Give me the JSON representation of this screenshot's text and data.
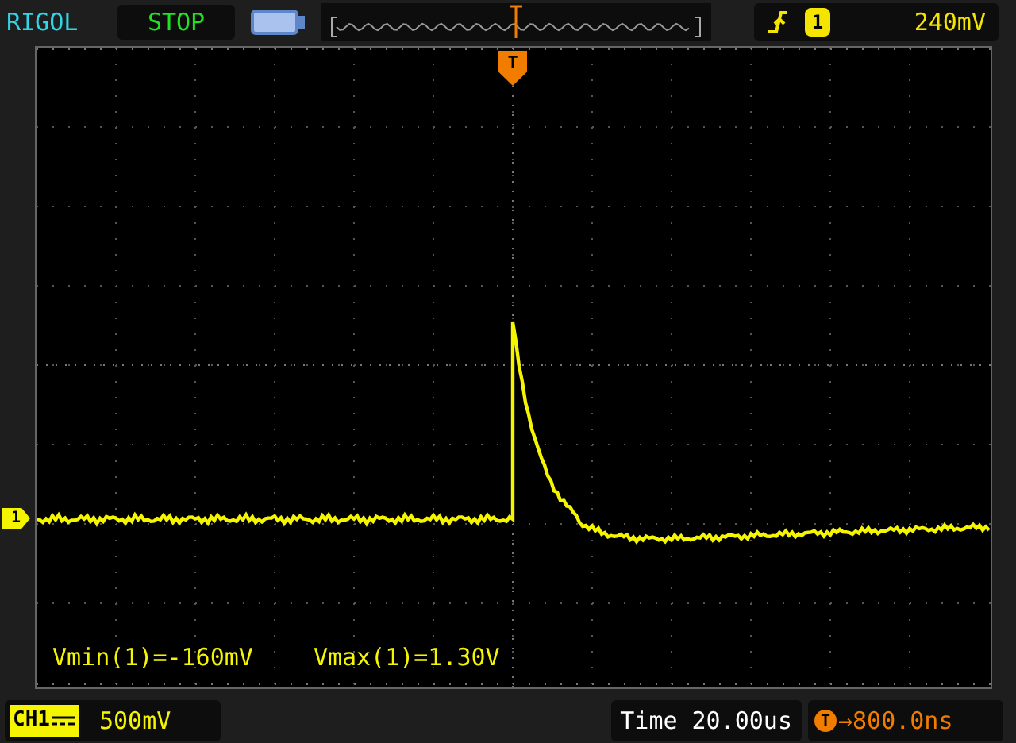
{
  "header": {
    "brand": "RIGOL",
    "run_state": "STOP"
  },
  "trigger": {
    "channel": "1",
    "level": "240mV"
  },
  "trigger_marker": "T",
  "channel_marker": "1",
  "measurements": [
    {
      "label": "Vmin(1)=",
      "value": "-160mV"
    },
    {
      "label": "Vmax(1)=",
      "value": "1.30V"
    }
  ],
  "channel": {
    "label": "CH1",
    "scale": "500mV"
  },
  "timebase": {
    "label": "Time",
    "value": "20.00us"
  },
  "trigger_offset": {
    "marker": "T",
    "value": "→800.0ns"
  }
}
